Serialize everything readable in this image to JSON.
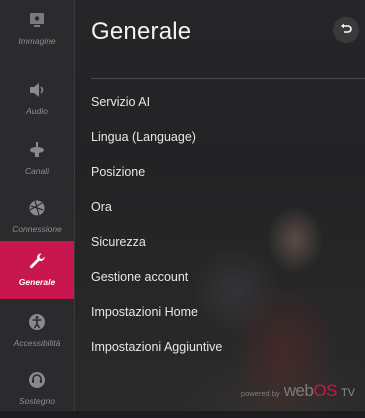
{
  "sidebar": {
    "items": [
      {
        "label": "Immagine",
        "icon": "picture-icon"
      },
      {
        "label": "Audio",
        "icon": "speaker-icon"
      },
      {
        "label": "Canali",
        "icon": "antenna-icon"
      },
      {
        "label": "Connessione",
        "icon": "globe-icon"
      },
      {
        "label": "Generale",
        "icon": "wrench-icon",
        "active": true
      },
      {
        "label": "Accessibilità",
        "icon": "accessibility-icon"
      },
      {
        "label": "Sostegno",
        "icon": "support-icon"
      }
    ],
    "accent_color": "#c8174f"
  },
  "main": {
    "title": "Generale",
    "back_icon": "back-icon",
    "menu": [
      "Servizio AI",
      "Lingua (Language)",
      "Posizione",
      "Ora",
      "Sicurezza",
      "Gestione account",
      "Impostazioni Home",
      "Impostazioni Aggiuntive"
    ]
  },
  "footer": {
    "powered_by": "powered by",
    "brand_web": "web",
    "brand_os": "OS",
    "brand_tv": "TV"
  }
}
